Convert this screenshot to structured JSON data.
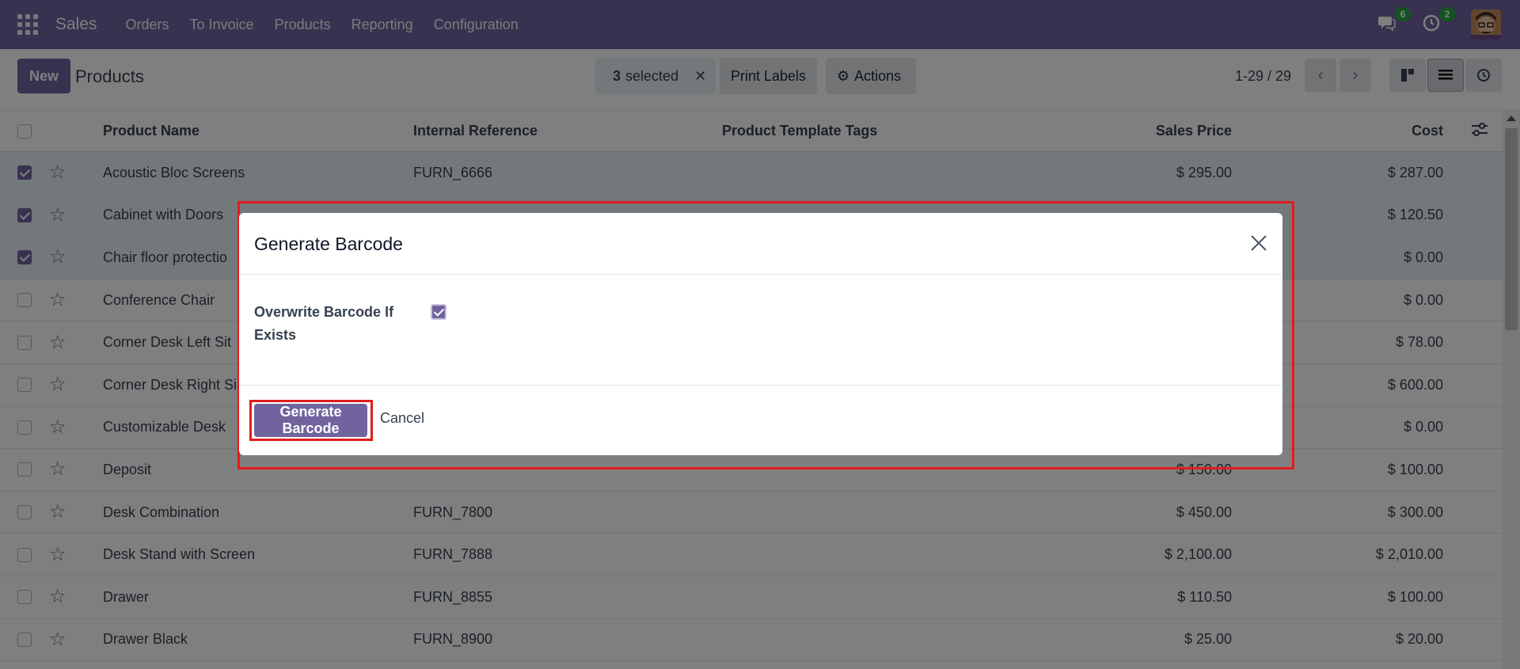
{
  "nav": {
    "brand": "Sales",
    "menu": [
      "Orders",
      "To Invoice",
      "Products",
      "Reporting",
      "Configuration"
    ],
    "messages_count": "6",
    "activities_count": "2"
  },
  "control": {
    "new_label": "New",
    "title": "Products",
    "selected_count": "3",
    "selected_label": "selected",
    "print_labels": "Print Labels",
    "actions": "Actions",
    "pager": "1-29 / 29"
  },
  "table": {
    "headers": {
      "name": "Product Name",
      "ref": "Internal Reference",
      "tags": "Product Template Tags",
      "price": "Sales Price",
      "cost": "Cost"
    },
    "rows": [
      {
        "name": "Acoustic Bloc Screens",
        "ref": "FURN_6666",
        "price": "$ 295.00",
        "cost": "$ 287.00",
        "selected": true
      },
      {
        "name": "Cabinet with Doors",
        "ref": "",
        "price": "",
        "cost": "$ 120.50",
        "selected": true
      },
      {
        "name": "Chair floor protectio",
        "ref": "",
        "price": "",
        "cost": "$ 0.00",
        "selected": true
      },
      {
        "name": "Conference Chair",
        "ref": "",
        "price": "",
        "cost": "$ 0.00",
        "selected": false
      },
      {
        "name": "Corner Desk Left Sit",
        "ref": "",
        "price": "",
        "cost": "$ 78.00",
        "selected": false
      },
      {
        "name": "Corner Desk Right Si",
        "ref": "",
        "price": "",
        "cost": "$ 600.00",
        "selected": false
      },
      {
        "name": "Customizable Desk",
        "ref": "",
        "price": "",
        "cost": "$ 0.00",
        "selected": false
      },
      {
        "name": "Deposit",
        "ref": "",
        "price": "$ 150.00",
        "cost": "$ 100.00",
        "selected": false
      },
      {
        "name": "Desk Combination",
        "ref": "FURN_7800",
        "price": "$ 450.00",
        "cost": "$ 300.00",
        "selected": false
      },
      {
        "name": "Desk Stand with Screen",
        "ref": "FURN_7888",
        "price": "$ 2,100.00",
        "cost": "$ 2,010.00",
        "selected": false
      },
      {
        "name": "Drawer",
        "ref": "FURN_8855",
        "price": "$ 110.50",
        "cost": "$ 100.00",
        "selected": false
      },
      {
        "name": "Drawer Black",
        "ref": "FURN_8900",
        "price": "$ 25.00",
        "cost": "$ 20.00",
        "selected": false
      }
    ]
  },
  "dialog": {
    "title": "Generate Barcode",
    "field_label": "Overwrite Barcode If Exists",
    "field_checked": true,
    "generate_label": "Generate Barcode",
    "cancel_label": "Cancel"
  },
  "colors": {
    "brand": "#71639e",
    "highlight": "#e11d1d"
  }
}
